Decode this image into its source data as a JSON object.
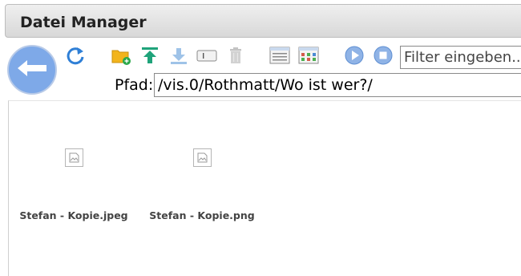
{
  "window": {
    "title": "Datei Manager"
  },
  "toolbar": {
    "back": "back-arrow-icon",
    "buttons": [
      {
        "name": "refresh-button",
        "icon": "refresh-icon"
      },
      {
        "name": "new-folder-button",
        "icon": "new-folder-icon"
      },
      {
        "name": "upload-button",
        "icon": "upload-icon"
      },
      {
        "name": "download-button",
        "icon": "download-icon"
      },
      {
        "name": "rename-button",
        "icon": "rename-icon"
      },
      {
        "name": "delete-button",
        "icon": "trash-icon"
      },
      {
        "name": "list-view-button",
        "icon": "list-view-icon"
      },
      {
        "name": "details-view-button",
        "icon": "table-view-icon"
      },
      {
        "name": "play-button",
        "icon": "play-icon"
      },
      {
        "name": "stop-button",
        "icon": "stop-icon"
      }
    ],
    "filter_placeholder": "Filter eingeben..."
  },
  "path": {
    "label": "Pfad:",
    "value": "/vis.0/Rothmatt/Wo ist wer?/"
  },
  "files": [
    {
      "name": "Stefan - Kopie.jpeg",
      "icon": "broken-image-icon"
    },
    {
      "name": "Stefan - Kopie.png",
      "icon": "broken-image-icon"
    }
  ],
  "colors": {
    "accent": "#7ea9e8",
    "toolbar_blue": "#2f7fd6",
    "green": "#1fa37a"
  }
}
